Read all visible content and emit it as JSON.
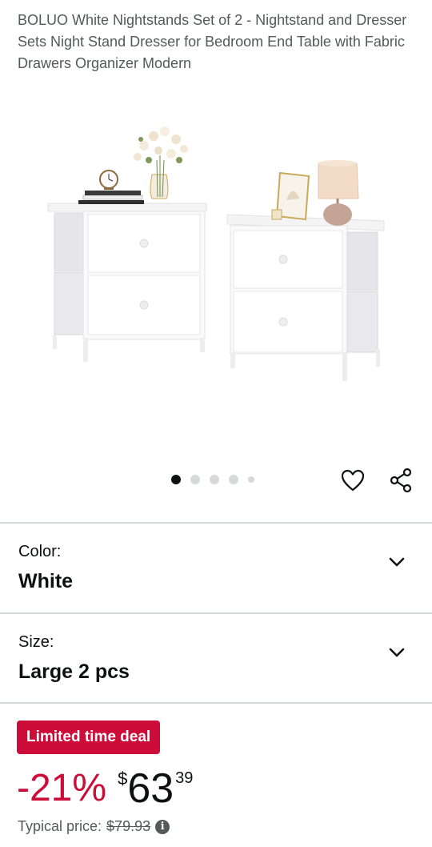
{
  "product": {
    "title": "BOLUO White Nightstands Set of 2 - Nightstand and Dresser Sets Night Stand Dresser for Bedroom End Table with Fabric Drawers Organizer Modern",
    "image_icon": "product-photo"
  },
  "gallery": {
    "total_images": 5,
    "active_index": 0
  },
  "actions": {
    "favorite_icon": "heart-icon",
    "share_icon": "share-icon"
  },
  "options": {
    "color": {
      "label": "Color:",
      "value": "White"
    },
    "size": {
      "label": "Size:",
      "value": "Large 2 pcs"
    }
  },
  "deal": {
    "badge": "Limited time deal",
    "badge_color": "#cc0c39",
    "discount": "-21%",
    "currency": "$",
    "price_whole": "63",
    "price_fraction": "39",
    "typical_label": "Typical price:",
    "typical_price": "$79.93"
  }
}
